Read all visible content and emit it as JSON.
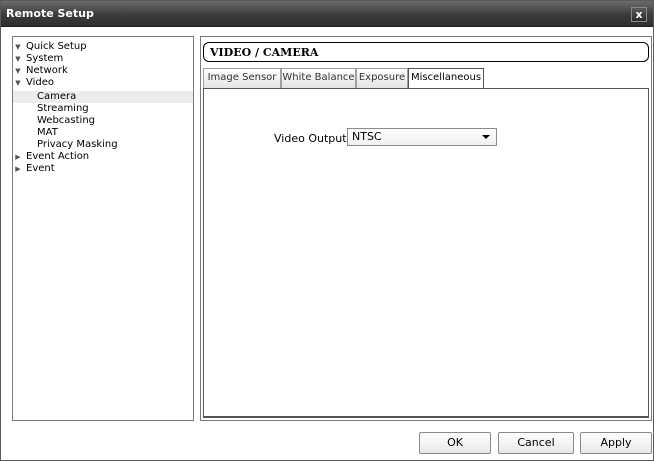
{
  "window": {
    "title": "Remote Setup",
    "close_label": "x"
  },
  "tree": {
    "items": [
      {
        "label": "Quick Setup",
        "arrow": "▼"
      },
      {
        "label": "System",
        "arrow": "▼"
      },
      {
        "label": "Network",
        "arrow": "▼"
      },
      {
        "label": "Video",
        "arrow": "▼"
      },
      {
        "label": "Camera",
        "arrow": "",
        "selected": true
      },
      {
        "label": "Streaming",
        "arrow": ""
      },
      {
        "label": "Webcasting",
        "arrow": ""
      },
      {
        "label": "MAT",
        "arrow": ""
      },
      {
        "label": "Privacy Masking",
        "arrow": ""
      },
      {
        "label": "Event Action",
        "arrow": "▶"
      },
      {
        "label": "Event",
        "arrow": "▶"
      }
    ]
  },
  "page": {
    "title": "VIDEO / CAMERA"
  },
  "tabs": [
    {
      "label": "Image Sensor"
    },
    {
      "label": "White Balance"
    },
    {
      "label": "Exposure"
    },
    {
      "label": "Miscellaneous",
      "active": true
    }
  ],
  "video_output": {
    "label": "Video Output",
    "value": "NTSC"
  },
  "buttons": {
    "ok": "OK",
    "cancel": "Cancel",
    "apply": "Apply"
  }
}
